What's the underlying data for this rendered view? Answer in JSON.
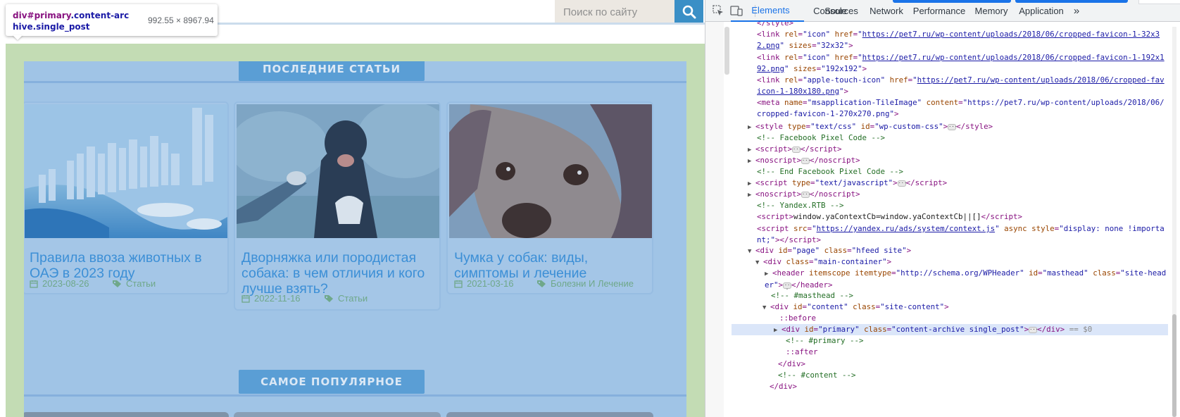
{
  "site": {
    "search_placeholder": "Поиск по сайту",
    "sections": [
      {
        "label": "ПОСЛЕДНИЕ СТАТЬИ"
      },
      {
        "label": "САМОЕ ПОПУЛЯРНОЕ"
      }
    ],
    "cards": [
      {
        "title": "Правила ввоза животных в ОАЭ в 2023 году",
        "date": "2023-08-26",
        "category": "Статьи",
        "image": "dubai-marina-aerial"
      },
      {
        "title": "Дворняжка или породистая собака: в чем отличия и кого лучше взять?",
        "date": "2022-11-16",
        "category": "Статьи",
        "image": "black-dog-giving-paw"
      },
      {
        "title": "Чумка у собак: виды, симптомы и лечение",
        "date": "2021-03-16",
        "category": "Болезни И Лечение",
        "image": "beagle-closeup"
      }
    ]
  },
  "tooltip": {
    "selector_tag": "div",
    "selector_id": "#primary",
    "selector_classes": ".content-archive.single_post",
    "size": "992.55 × 8967.94"
  },
  "devtools": {
    "tabs": [
      {
        "label": "Elements",
        "active": true
      },
      {
        "label": "Console"
      },
      {
        "label": "Sources"
      },
      {
        "label": "Network"
      },
      {
        "label": "Performance"
      },
      {
        "label": "Memory"
      },
      {
        "label": "Application"
      }
    ],
    "more_tabs_icon": "»",
    "selected_suffix": "== $0",
    "selected_dots": "…",
    "colors": {
      "accent": "#1a73e8",
      "tag": "#881280",
      "attr_name": "#994500",
      "attr_value": "#1a1aa6",
      "comment": "#236e25"
    }
  },
  "colors": {
    "primary_overlay": "#a0c4e6",
    "padding_overlay": "#c3dcb4",
    "card_title": "#3c8fd6",
    "meta": "#6fa88a",
    "search_button": "#3a8fc6"
  }
}
